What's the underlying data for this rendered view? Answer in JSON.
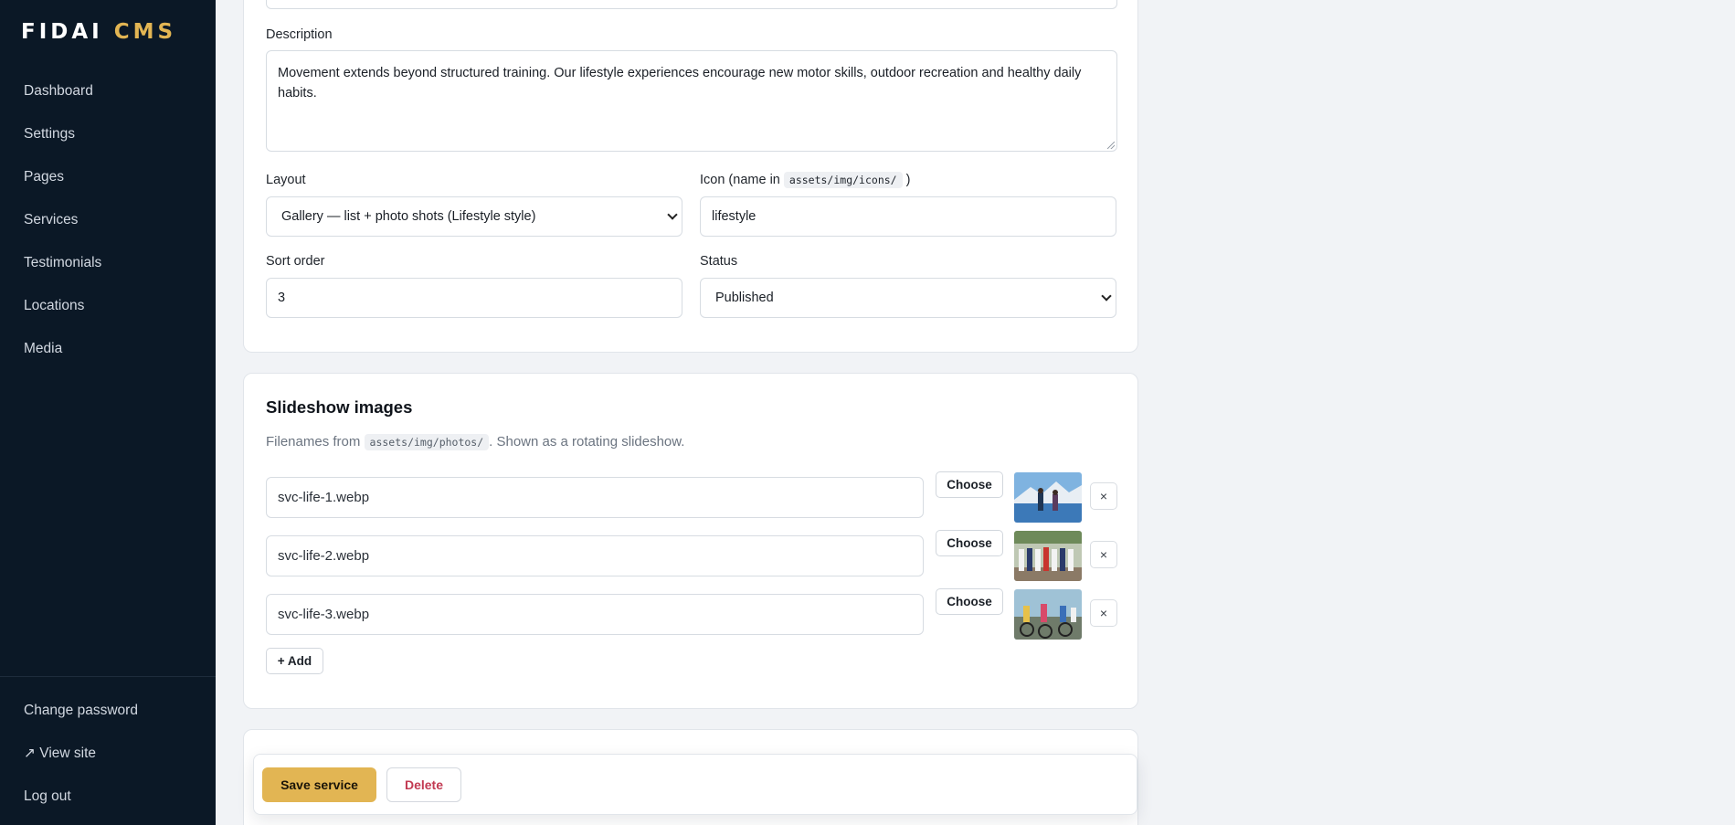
{
  "brand": {
    "name": "FIDAI",
    "accent": "CMS"
  },
  "sidebar": {
    "items": [
      {
        "label": "Dashboard"
      },
      {
        "label": "Settings"
      },
      {
        "label": "Pages"
      },
      {
        "label": "Services"
      },
      {
        "label": "Testimonials"
      },
      {
        "label": "Locations"
      },
      {
        "label": "Media"
      }
    ],
    "bottom": [
      {
        "label": "Change password"
      },
      {
        "label": "↗ View site"
      },
      {
        "label": "Log out"
      }
    ]
  },
  "form": {
    "description": {
      "label": "Description",
      "value": "Movement extends beyond structured training. Our lifestyle experiences encourage new motor skills, outdoor recreation and healthy daily habits."
    },
    "layout": {
      "label": "Layout",
      "value": "Gallery — list + photo shots (Lifestyle style)"
    },
    "icon": {
      "label_prefix": "Icon (name in",
      "label_code": "assets/img/icons/",
      "label_suffix": ")",
      "value": "lifestyle"
    },
    "sort_order": {
      "label": "Sort order",
      "value": "3"
    },
    "status": {
      "label": "Status",
      "value": "Published"
    }
  },
  "slideshow": {
    "title": "Slideshow images",
    "sub_prefix": "Filenames from",
    "sub_code": "assets/img/photos/",
    "sub_suffix": ". Shown as a rotating slideshow.",
    "choose_label": "Choose",
    "remove_label": "×",
    "add_label": "+ Add",
    "images": [
      {
        "filename": "svc-life-1.webp"
      },
      {
        "filename": "svc-life-2.webp"
      },
      {
        "filename": "svc-life-3.webp"
      }
    ]
  },
  "actions": {
    "save_label": "Save service",
    "delete_label": "Delete"
  },
  "colors": {
    "sidebar_bg": "#0b1826",
    "accent": "#e2b553",
    "danger": "#c23a52"
  }
}
